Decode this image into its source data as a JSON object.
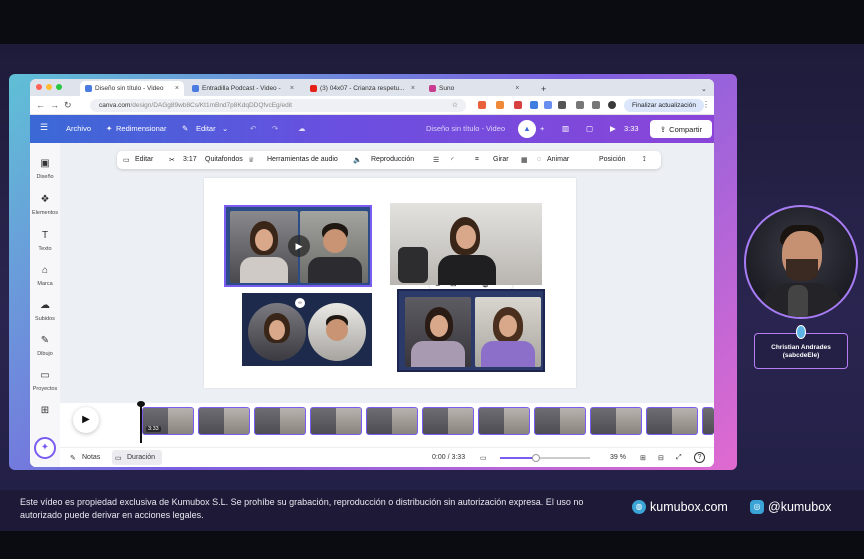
{
  "browser": {
    "tabs": [
      {
        "label": "Diseño sin título - Video",
        "close": "×"
      },
      {
        "label": "Entradilla Podcast - Video -",
        "close": "×"
      },
      {
        "label": "(3) 04x07 - Crianza respetu...",
        "close": "×"
      },
      {
        "label": "Suno",
        "close": "×"
      }
    ],
    "new_tab": "+",
    "url_domain": "canva.com",
    "url_path": "/design/DAGg89wb8Cs/Kt1mBnd7p8KdqDDQfvcEg/edit",
    "update_label": "Finalizar actualización"
  },
  "canva": {
    "menu": {
      "archivo": "Archivo",
      "redimensionar": "Redimensionar",
      "editar": "Editar",
      "doc_title": "Diseño sin título - Video",
      "duration": "3:33",
      "share": "Compartir"
    },
    "sidebar": [
      {
        "label": "Diseño",
        "icon": "layout-icon"
      },
      {
        "label": "Elementos",
        "icon": "shapes-icon"
      },
      {
        "label": "Texto",
        "icon": "text-icon"
      },
      {
        "label": "Marca",
        "icon": "brand-icon"
      },
      {
        "label": "Subidos",
        "icon": "cloud-upload-icon"
      },
      {
        "label": "Dibujo",
        "icon": "pen-icon"
      },
      {
        "label": "Proyectos",
        "icon": "folder-icon"
      },
      {
        "label": "",
        "icon": "apps-icon"
      }
    ],
    "toolbar": {
      "editar": "Editar",
      "time": "3:17",
      "quitafondos": "Quitafondos",
      "audio": "Herramientas de audio",
      "reproduccion": "Reproducción",
      "girar": "Girar",
      "animar": "Animar",
      "posicion": "Posición"
    },
    "mini_toolbar": {
      "more": "•••"
    },
    "clip_time": "3:33",
    "bottom": {
      "notas": "Notas",
      "duracion": "Duración",
      "time": "0:00 / 3:33",
      "zoom": "39 %",
      "help": "?"
    }
  },
  "presenter": {
    "name": "Christian Andrades",
    "handle": "(sabcdeEle)"
  },
  "footer": {
    "disclaimer": "Este vídeo es propiedad exclusiva de Kumubox S.L. Se prohíbe su grabación, reproducción o distribución sin autorización expresa. El uso no autorizado puede derivar en acciones legales.",
    "site": "kumubox.com",
    "instagram": "@kumubox"
  },
  "colors": {
    "accent": "#7a5cf0",
    "canva_bar_start": "#3a69d6",
    "canva_bar_end": "#8a45d8",
    "stage_bg": "#231f47"
  }
}
